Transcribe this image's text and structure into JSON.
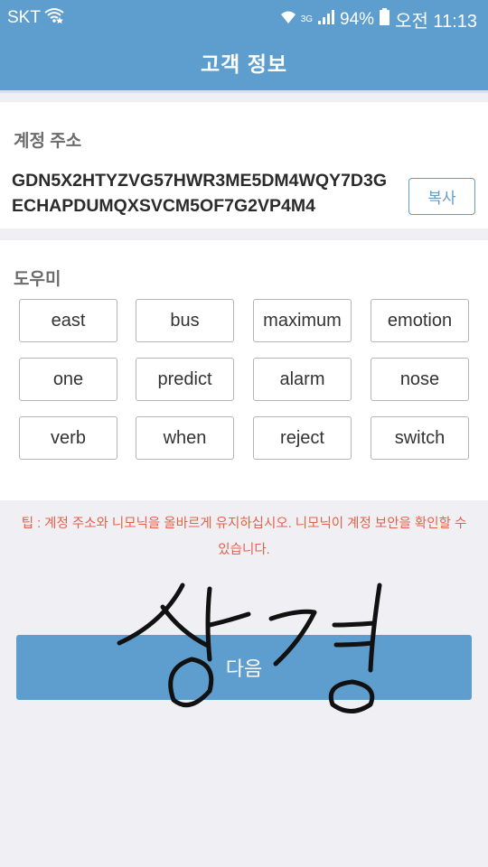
{
  "status_bar": {
    "carrier": "SKT",
    "network": "3G",
    "battery": "94%",
    "time": "오전 11:13"
  },
  "header": {
    "title": "고객 정보"
  },
  "account": {
    "label": "계정 주소",
    "address": "GDN5X2HTYZVG57HWR3ME5DM4WQY7D3GECHAPDUMQXSVCM5OF7G2VP4M4",
    "copy_label": "복사"
  },
  "mnemonic": {
    "label": "도우미",
    "words": [
      "east",
      "bus",
      "maximum",
      "emotion",
      "one",
      "predict",
      "alarm",
      "nose",
      "verb",
      "when",
      "reject",
      "switch"
    ]
  },
  "tip": "팁 : 계정 주소와 니모닉을 올바르게 유지하십시오. 니모닉이 계정 보안을 확인할 수 있습니다.",
  "next_button": {
    "label": "다음"
  },
  "signature": {
    "text": "상경"
  }
}
